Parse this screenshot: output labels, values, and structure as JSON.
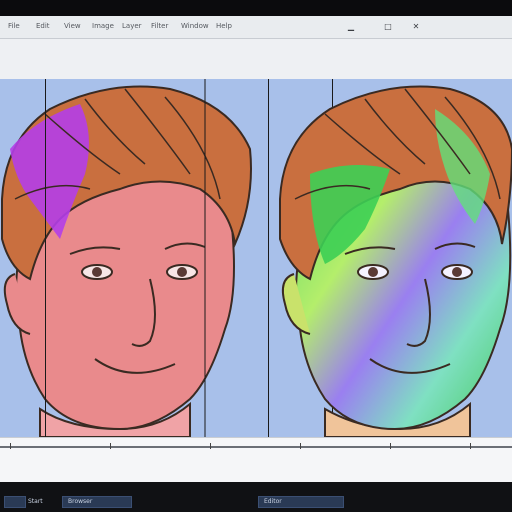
{
  "menubar": {
    "items": [
      "File",
      "Edit",
      "View",
      "Image",
      "Layer",
      "Filter",
      "Window",
      "Help"
    ],
    "controls": [
      "minimize",
      "maximize",
      "close"
    ]
  },
  "panels": [
    {
      "name": "left-face-panel"
    },
    {
      "name": "right-face-panel"
    }
  ],
  "taskbar": {
    "items": [
      "Start",
      "Browser",
      "Editor"
    ]
  },
  "colors": {
    "canvas": "#a8c0ea",
    "skin_left": "#e98a8c",
    "skin_right": "#8fd58b",
    "hair": "#c96f3f",
    "magenta": "#b43ee8",
    "green": "#3dcf54"
  },
  "icons": [
    "minimize-icon",
    "maximize-icon",
    "close-icon",
    "start-icon",
    "browser-icon",
    "editor-icon"
  ]
}
